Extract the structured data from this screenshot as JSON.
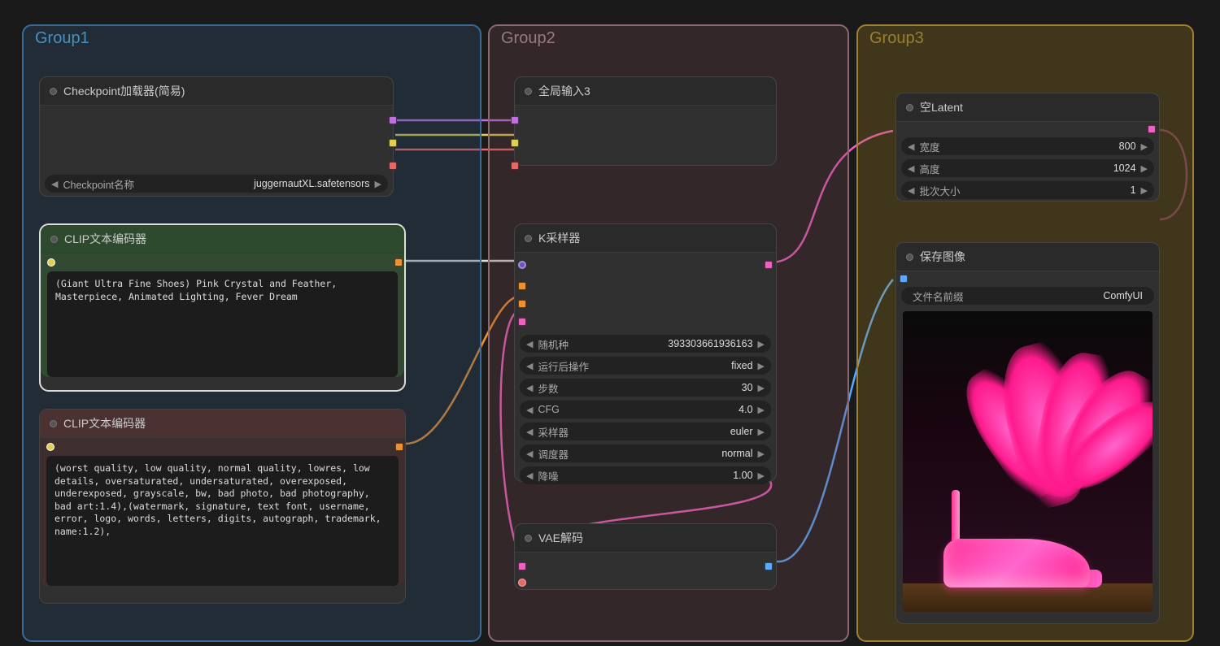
{
  "groups": {
    "g1": "Group1",
    "g2": "Group2",
    "g3": "Group3"
  },
  "checkpoint": {
    "title": "Checkpoint加载器(简易)",
    "name_label": "Checkpoint名称",
    "name_value": "juggernautXL.safetensors"
  },
  "clip_pos": {
    "title": "CLIP文本编码器",
    "text": "(Giant Ultra Fine Shoes) Pink Crystal and Feather, Masterpiece, Animated Lighting, Fever Dream"
  },
  "clip_neg": {
    "title": "CLIP文本编码器",
    "text": "(worst quality, low quality, normal quality, lowres, low details, oversaturated, undersaturated, overexposed, underexposed, grayscale, bw, bad photo, bad photography, bad art:1.4),(watermark, signature, text font, username, error, logo, words, letters, digits, autograph, trademark, name:1.2),"
  },
  "global_input": {
    "title": "全局输入3"
  },
  "ksampler": {
    "title": "K采样器",
    "seed": {
      "label": "随机种",
      "value": "393303661936163"
    },
    "after": {
      "label": "运行后操作",
      "value": "fixed"
    },
    "steps": {
      "label": "步数",
      "value": "30"
    },
    "cfg": {
      "label": "CFG",
      "value": "4.0"
    },
    "sampler": {
      "label": "采样器",
      "value": "euler"
    },
    "scheduler": {
      "label": "调度器",
      "value": "normal"
    },
    "denoise": {
      "label": "降噪",
      "value": "1.00"
    }
  },
  "vae": {
    "title": "VAE解码"
  },
  "latent": {
    "title": "空Latent",
    "width": {
      "label": "宽度",
      "value": "800"
    },
    "height": {
      "label": "高度",
      "value": "1024"
    },
    "batch": {
      "label": "批次大小",
      "value": "1"
    }
  },
  "save": {
    "title": "保存图像",
    "prefix_label": "文件名前缀",
    "prefix_value": "ComfyUI"
  }
}
